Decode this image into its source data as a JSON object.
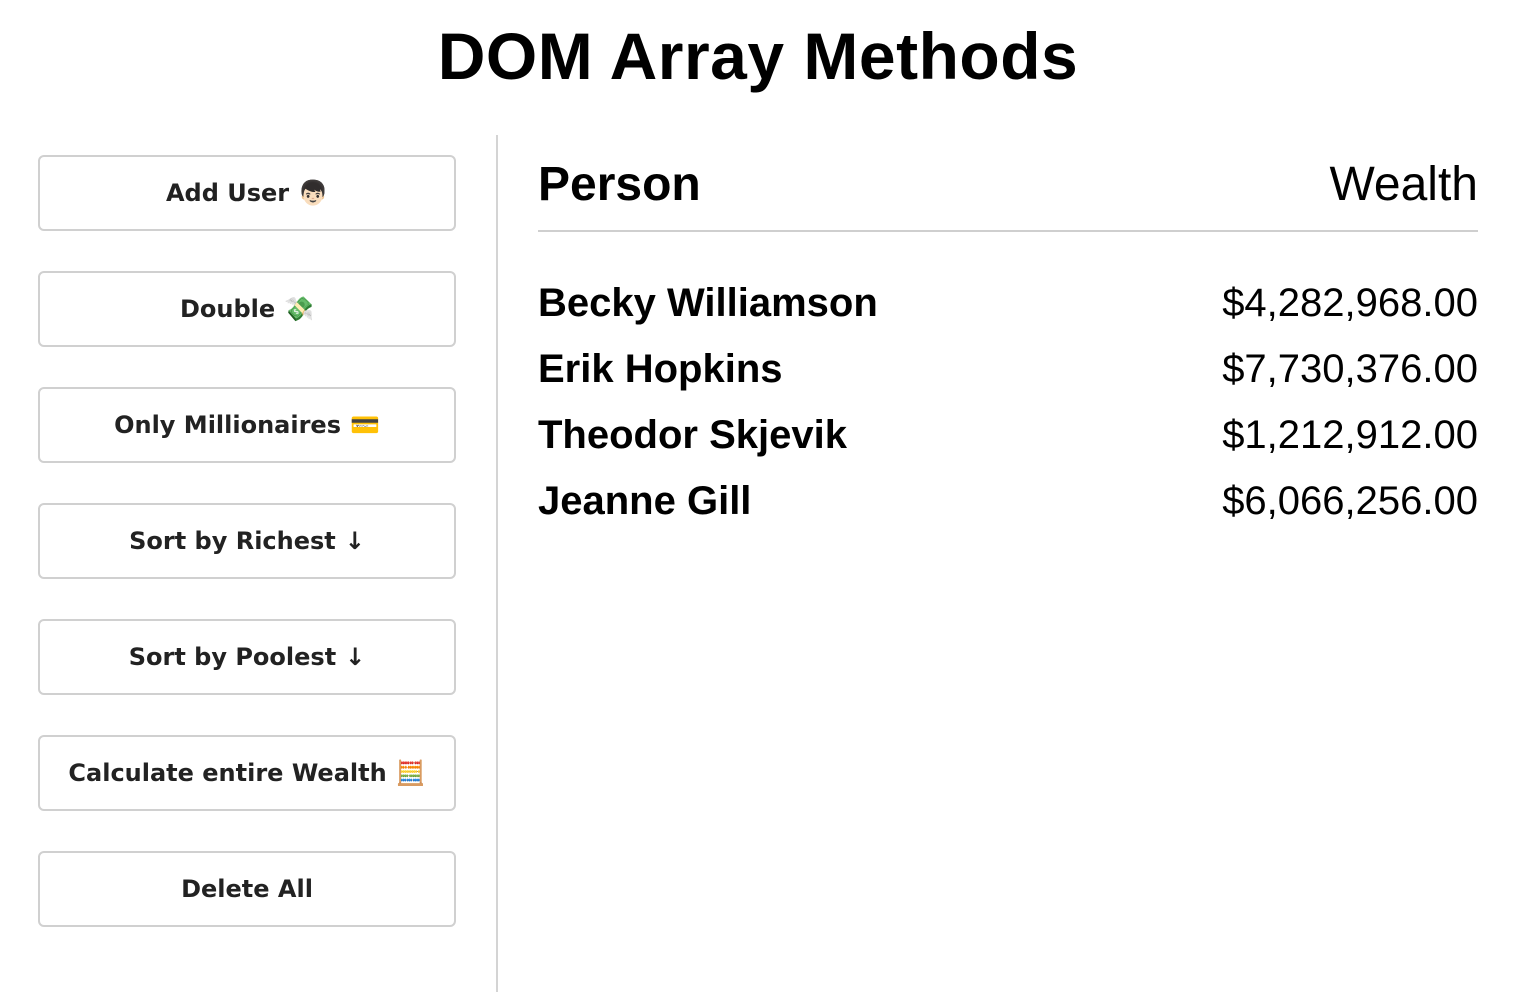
{
  "title": "DOM Array Methods",
  "sidebar": {
    "buttons": [
      {
        "label": "Add User",
        "icon": "👦🏻",
        "icon_name": "person-icon"
      },
      {
        "label": "Double",
        "icon": "💸",
        "icon_name": "money-wings-icon"
      },
      {
        "label": "Only Millionaires",
        "icon": "💳",
        "icon_name": "credit-card-icon"
      },
      {
        "label": "Sort by Richest",
        "icon": "↓",
        "icon_name": "arrow-down-icon"
      },
      {
        "label": "Sort by Poolest",
        "icon": "↓",
        "icon_name": "arrow-down-icon"
      },
      {
        "label": "Calculate entire Wealth",
        "icon": "🧮",
        "icon_name": "abacus-icon"
      },
      {
        "label": "Delete All",
        "icon": "",
        "icon_name": ""
      }
    ]
  },
  "table": {
    "header_person": "Person",
    "header_wealth": "Wealth",
    "rows": [
      {
        "name": "Becky Williamson",
        "wealth": "$4,282,968.00"
      },
      {
        "name": "Erik Hopkins",
        "wealth": "$7,730,376.00"
      },
      {
        "name": "Theodor Skjevik",
        "wealth": "$1,212,912.00"
      },
      {
        "name": "Jeanne Gill",
        "wealth": "$6,066,256.00"
      }
    ]
  },
  "colors": {
    "border": "#d0d0d0",
    "button_text": "#222222",
    "divider": "#d4d4d4"
  }
}
